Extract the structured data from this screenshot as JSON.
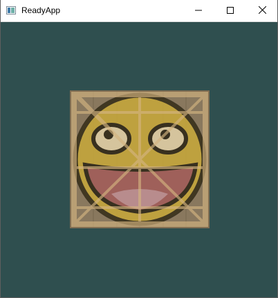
{
  "window": {
    "title": "ReadyApp",
    "background_color": "#2f4f4f"
  },
  "titlebar": {
    "app_icon": "window-app-icon",
    "minimize_icon": "minimize-icon",
    "maximize_icon": "maximize-icon",
    "close_icon": "close-icon"
  },
  "scene": {
    "texture": "crate-with-smiley-face",
    "crate_color": "#b08a4a",
    "face_color": "#c8a83a",
    "mouth_color": "#9c5a5e",
    "outline_color": "#2a241c"
  }
}
